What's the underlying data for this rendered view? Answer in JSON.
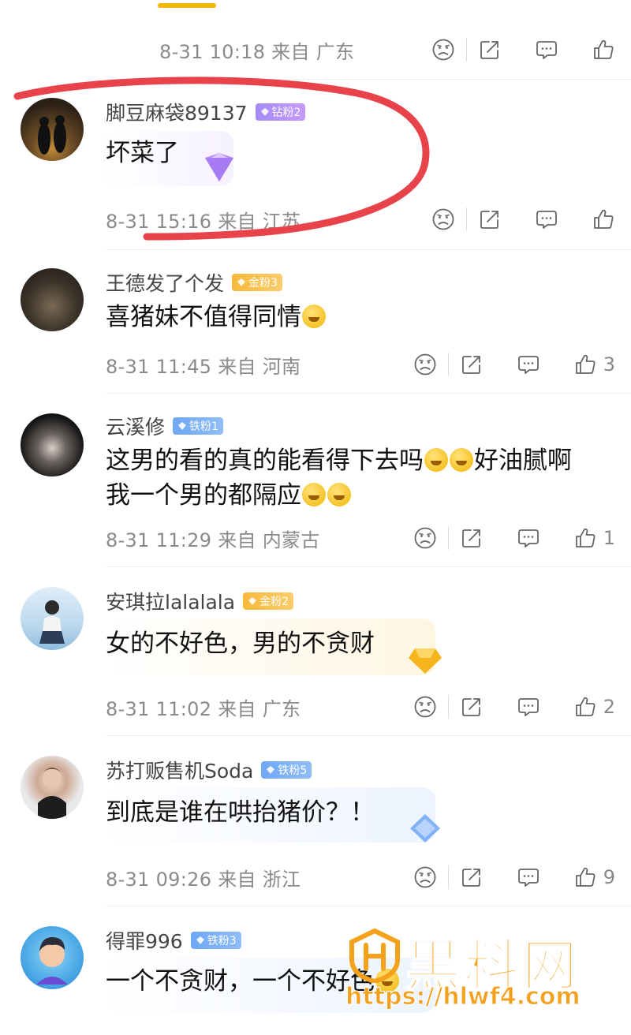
{
  "colors": {
    "tab_accent": "#f2b705",
    "red_mark": "#e8434b",
    "watermark": "#f4a21b"
  },
  "top_comment": {
    "meta": "8-31 10:18 来自 广东"
  },
  "comments": [
    {
      "name": "脚豆麻袋89137",
      "badge": "钻粉2",
      "badge_type": "diamond",
      "text": "坏菜了",
      "meta": "8-31 15:16 来自 江苏",
      "likes": ""
    },
    {
      "name": "王德发了个发",
      "badge": "金粉3",
      "badge_type": "gold",
      "text": "喜猪妹不值得同情",
      "meta": "8-31 11:45 来自 河南",
      "likes": "3"
    },
    {
      "name": "云溪修",
      "badge": "铁粉1",
      "badge_type": "iron",
      "text_line1": "这男的看的真的能看得下去吗",
      "text_line1b": "好油腻啊",
      "text_line2": "我一个男的都隔应",
      "meta": "8-31 11:29 来自 内蒙古",
      "likes": "1"
    },
    {
      "name": "安琪拉lalalala",
      "badge": "金粉2",
      "badge_type": "gold",
      "text": "女的不好色，男的不贪财",
      "meta": "8-31 11:02 来自 广东",
      "likes": "2"
    },
    {
      "name": "苏打贩售机Soda",
      "badge": "铁粉5",
      "badge_type": "iron",
      "text": "到底是谁在哄抬猪价？！",
      "meta": "8-31 09:26 来自 浙江",
      "likes": "9"
    },
    {
      "name": "得罪996",
      "badge": "铁粉3",
      "badge_type": "iron",
      "text": "一个不贪财，一个不好色",
      "meta": "",
      "likes": ""
    }
  ],
  "icons": [
    "sad-face-icon",
    "share-icon",
    "comment-icon",
    "thumbs-up-icon"
  ],
  "watermark": {
    "title": "黑料网",
    "url": "https://hlwf4.com"
  }
}
